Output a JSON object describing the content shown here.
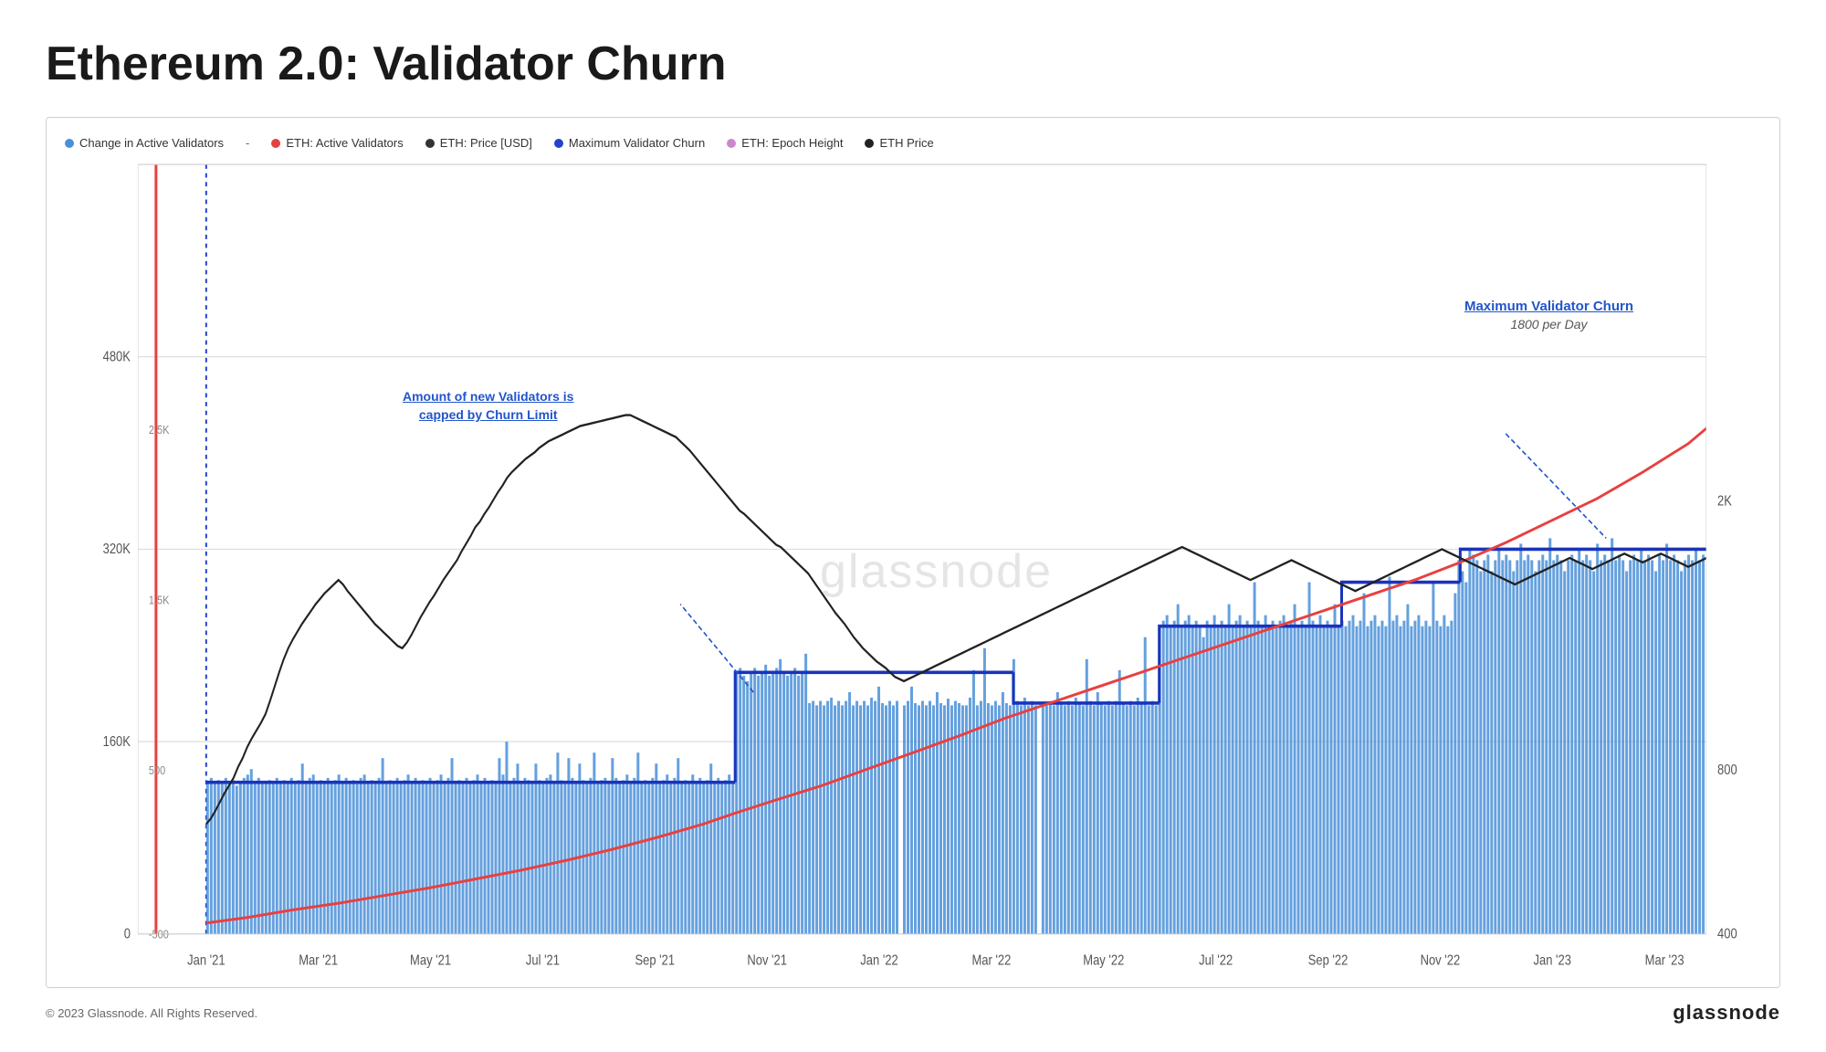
{
  "title": "Ethereum 2.0: Validator Churn",
  "legend": {
    "items": [
      {
        "label": "Change in Active Validators",
        "type": "dot",
        "color": "#4a90d9"
      },
      {
        "label": "-",
        "type": "text",
        "color": "#333"
      },
      {
        "label": "ETH: Active Validators",
        "type": "dot",
        "color": "#e84040"
      },
      {
        "label": "ETH: Price [USD]",
        "type": "dot",
        "color": "#333"
      },
      {
        "label": "Maximum Validator Churn",
        "type": "dot",
        "color": "#2244cc"
      },
      {
        "label": "ETH: Epoch Height",
        "type": "dot",
        "color": "#cc88cc"
      },
      {
        "label": "ETH Price",
        "type": "dot",
        "color": "#222"
      }
    ]
  },
  "annotations": {
    "churn_limit": {
      "line1": "Amount of new Validators is",
      "line2": "capped by Churn Limit"
    },
    "max_validator_churn": {
      "title": "Maximum Validator Churn",
      "subtitle": "1800 per Day"
    }
  },
  "y_left_labels": [
    "0",
    "160K",
    "320K",
    "480K"
  ],
  "y_right_labels": [
    "400",
    "800",
    "2K"
  ],
  "y_left_mid_labels": [
    "-500",
    "500",
    "1.5K",
    "2.5K"
  ],
  "x_labels": [
    "Jan '21",
    "Mar '21",
    "May '21",
    "Jul '21",
    "Sep '21",
    "Nov '21",
    "Jan '22",
    "Mar '22",
    "May '22",
    "Jul '22",
    "Sep '22",
    "Nov '22",
    "Jan '23",
    "Mar '23"
  ],
  "footer": {
    "copyright": "© 2023 Glassnode. All Rights Reserved.",
    "logo": "glassnode"
  },
  "watermark": "glassnode"
}
